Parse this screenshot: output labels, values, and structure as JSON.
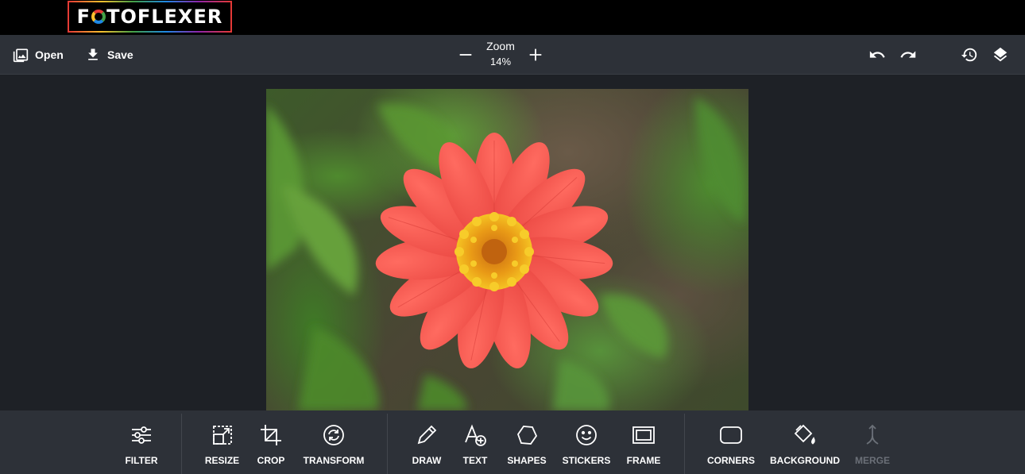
{
  "logo": {
    "text_before": "F",
    "text_after": "TOFLEXER",
    "ring_colors": [
      "#e53935",
      "#43a047",
      "#1e88e5",
      "#fbc02d"
    ]
  },
  "toolbar": {
    "open_label": "Open",
    "save_label": "Save",
    "zoom_label": "Zoom",
    "zoom_value": "14%",
    "icons": {
      "open": "image-icon",
      "save": "download-icon",
      "zoom_out": "minus-icon",
      "zoom_in": "plus-icon",
      "undo": "undo-icon",
      "redo": "redo-icon",
      "history": "history-icon",
      "layers": "layers-icon"
    }
  },
  "tools": [
    {
      "id": "filter",
      "label": "FILTER",
      "icon": "sliders-icon",
      "enabled": true
    },
    {
      "id": "resize",
      "label": "RESIZE",
      "icon": "resize-icon",
      "enabled": true
    },
    {
      "id": "crop",
      "label": "CROP",
      "icon": "crop-icon",
      "enabled": true
    },
    {
      "id": "transform",
      "label": "TRANSFORM",
      "icon": "rotate-icon",
      "enabled": true
    },
    {
      "id": "draw",
      "label": "DRAW",
      "icon": "pencil-icon",
      "enabled": true
    },
    {
      "id": "text",
      "label": "TEXT",
      "icon": "add-text-icon",
      "enabled": true
    },
    {
      "id": "shapes",
      "label": "SHAPES",
      "icon": "hexagon-icon",
      "enabled": true
    },
    {
      "id": "stickers",
      "label": "STICKERS",
      "icon": "smiley-icon",
      "enabled": true
    },
    {
      "id": "frame",
      "label": "FRAME",
      "icon": "frame-icon",
      "enabled": true
    },
    {
      "id": "corners",
      "label": "CORNERS",
      "icon": "rounded-square-icon",
      "enabled": true
    },
    {
      "id": "background",
      "label": "BACKGROUND",
      "icon": "paint-bucket-icon",
      "enabled": true
    },
    {
      "id": "merge",
      "label": "MERGE",
      "icon": "merge-icon",
      "enabled": false
    }
  ],
  "colors": {
    "app_background": "#1e2126",
    "toolbar_background": "#2d3138",
    "logo_bar_background": "#000000",
    "disabled_tool": "#6b7078",
    "flower_petal": "#f4554f",
    "flower_center": "#f0b419"
  }
}
